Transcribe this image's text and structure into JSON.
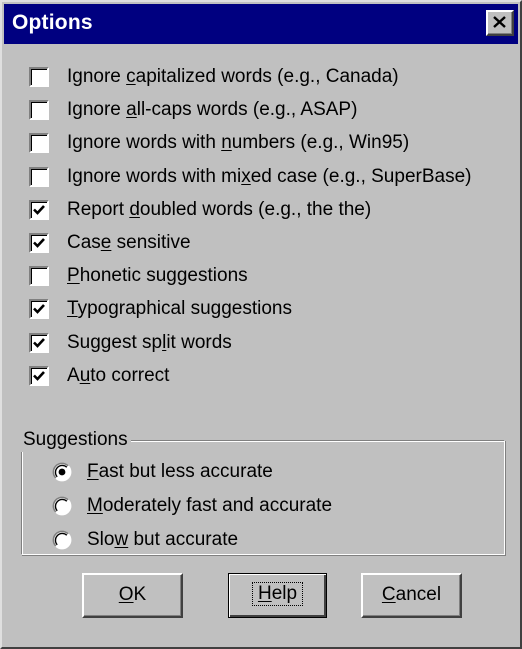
{
  "window": {
    "title": "Options",
    "close_icon": "close-icon",
    "colors": {
      "titlebar": "#000080",
      "face": "#c0c0c0"
    }
  },
  "options": [
    {
      "pre": "Ignore ",
      "mn": "c",
      "post": "apitalized words (e.g., Canada)",
      "checked": false
    },
    {
      "pre": "Ignore ",
      "mn": "a",
      "post": "ll-caps words (e.g., ASAP)",
      "checked": false
    },
    {
      "pre": "Ignore words with ",
      "mn": "n",
      "post": "umbers (e.g., Win95)",
      "checked": false
    },
    {
      "pre": "Ignore words with mi",
      "mn": "x",
      "post": "ed case (e.g., SuperBase)",
      "checked": false
    },
    {
      "pre": "Report ",
      "mn": "d",
      "post": "oubled words (e.g., the the)",
      "checked": true
    },
    {
      "pre": "Cas",
      "mn": "e",
      "post": " sensitive",
      "checked": true
    },
    {
      "pre": "",
      "mn": "P",
      "post": "honetic suggestions",
      "checked": false
    },
    {
      "pre": "",
      "mn": "T",
      "post": "ypographical suggestions",
      "checked": true
    },
    {
      "pre": "Suggest sp",
      "mn": "l",
      "post": "it words",
      "checked": true
    },
    {
      "pre": "A",
      "mn": "u",
      "post": "to correct",
      "checked": true
    }
  ],
  "suggestions": {
    "legend": "Suggestions",
    "options": [
      {
        "pre": "",
        "mn": "F",
        "post": "ast but less accurate",
        "selected": true
      },
      {
        "pre": "",
        "mn": "M",
        "post": "oderately fast and accurate",
        "selected": false
      },
      {
        "pre": "Slo",
        "mn": "w",
        "post": " but accurate",
        "selected": false
      }
    ]
  },
  "buttons": {
    "ok": {
      "pre": "",
      "mn": "O",
      "post": "K"
    },
    "help": {
      "pre": "",
      "mn": "H",
      "post": "elp"
    },
    "cancel": {
      "pre": "",
      "mn": "C",
      "post": "ancel"
    }
  }
}
